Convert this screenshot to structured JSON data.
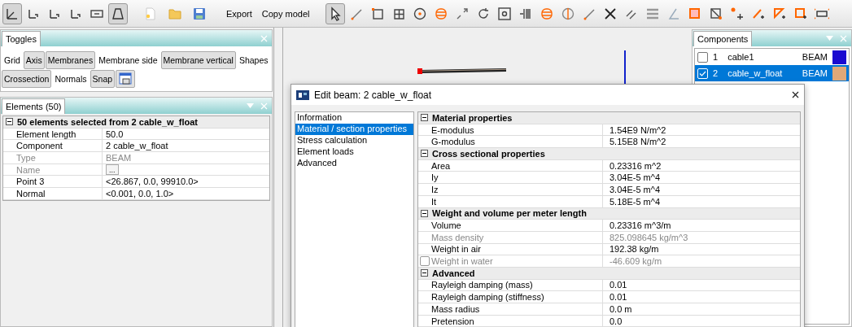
{
  "toolbar": {
    "view_tools": [
      {
        "pressed": true
      },
      {
        "pressed": false
      },
      {
        "pressed": false
      },
      {
        "pressed": false
      },
      {
        "pressed": false
      },
      {
        "pressed": true
      }
    ],
    "actions": [
      "Export",
      "Copy model"
    ],
    "draw_tools": [
      {
        "pressed": true
      },
      {
        "pressed": false
      },
      {
        "pressed": false
      },
      {
        "pressed": false
      },
      {
        "pressed": false
      },
      {
        "pressed": false
      },
      {
        "pressed": false
      },
      {
        "pressed": false
      },
      {
        "pressed": false
      },
      {
        "pressed": false
      },
      {
        "pressed": false
      },
      {
        "pressed": false
      },
      {
        "pressed": false
      },
      {
        "pressed": false
      },
      {
        "pressed": false
      },
      {
        "pressed": false
      },
      {
        "pressed": false
      },
      {
        "pressed": false
      },
      {
        "pressed": false
      },
      {
        "pressed": false
      },
      {
        "pressed": false
      },
      {
        "pressed": false
      },
      {
        "pressed": false
      },
      {
        "pressed": false
      }
    ]
  },
  "toggles": {
    "title": "Toggles",
    "items": [
      {
        "kind": "text",
        "label": "Grid",
        "on": false
      },
      {
        "kind": "text",
        "label": "Axis",
        "on": true
      },
      {
        "kind": "text",
        "label": "Membranes",
        "on": true
      },
      {
        "kind": "text",
        "label": "Membrane side",
        "on": false
      },
      {
        "kind": "text",
        "label": "Membrane vertical",
        "on": true
      },
      {
        "kind": "text",
        "label": "Shapes",
        "on": false
      },
      {
        "kind": "text",
        "label": "Crossection",
        "on": true
      },
      {
        "kind": "text",
        "label": "Normals",
        "on": false
      },
      {
        "kind": "text",
        "label": "Snap",
        "on": true
      },
      {
        "kind": "icon",
        "on": true
      }
    ]
  },
  "elements": {
    "title": "Elements (50)",
    "group": "50 elements selected from 2 cable_w_float",
    "rows": [
      {
        "name": "Element length",
        "value": "50.0",
        "disabled": false
      },
      {
        "name": "Component",
        "value": "2 cable_w_float",
        "disabled": false
      },
      {
        "name": "Type",
        "value": "BEAM",
        "disabled": true
      },
      {
        "name": "Name",
        "disabled": true,
        "button": "..."
      },
      {
        "name": "Point 3",
        "value": "<26.867, 0.0, 99910.0>",
        "disabled": false
      },
      {
        "name": "Normal",
        "value": "<0.001, 0.0, 1.0>",
        "disabled": false
      }
    ]
  },
  "components": {
    "title": "Components",
    "items": [
      {
        "number": "1",
        "name": "cable1",
        "type": "BEAM",
        "color": "#1a0ad0",
        "checked": false,
        "selected": false
      },
      {
        "number": "2",
        "name": "cable_w_float",
        "type": "BEAM",
        "color": "#e0a878",
        "checked": true,
        "selected": true
      }
    ]
  },
  "dialog": {
    "title": "Edit beam: 2 cable_w_float",
    "nav": [
      {
        "label": "Information",
        "selected": false
      },
      {
        "label": "Material / section properties",
        "selected": true
      },
      {
        "label": "Stress calculation",
        "selected": false
      },
      {
        "label": "Element loads",
        "selected": false
      },
      {
        "label": "Advanced",
        "selected": false
      }
    ],
    "groups": [
      {
        "title": "Material properties",
        "rows": [
          {
            "name": "E-modulus",
            "value": "1.54E9 N/m^2",
            "disabled": false
          },
          {
            "name": "G-modulus",
            "value": "5.15E8 N/m^2",
            "disabled": false
          }
        ]
      },
      {
        "title": "Cross sectional properties",
        "rows": [
          {
            "name": "Area",
            "value": "0.23316 m^2",
            "disabled": false
          },
          {
            "name": "Iy",
            "value": "3.04E-5 m^4",
            "disabled": false
          },
          {
            "name": "Iz",
            "value": "3.04E-5 m^4",
            "disabled": false
          },
          {
            "name": "It",
            "value": "5.18E-5 m^4",
            "disabled": false
          }
        ]
      },
      {
        "title": "Weight and volume per meter length",
        "rows": [
          {
            "name": "Volume",
            "value": "0.23316 m^3/m",
            "disabled": false
          },
          {
            "name": "Mass density",
            "value": "825.098645 kg/m^3",
            "disabled": true
          },
          {
            "name": "Weight in air",
            "value": "192.38 kg/m",
            "disabled": false
          },
          {
            "name": "Weight in water",
            "value": "-46.609 kg/m",
            "disabled": true,
            "checked": false
          }
        ]
      },
      {
        "title": "Advanced",
        "rows": [
          {
            "name": "Rayleigh damping (mass)",
            "value": "0.01",
            "disabled": false
          },
          {
            "name": "Rayleigh damping (stiffness)",
            "value": "0.01",
            "disabled": false
          },
          {
            "name": "Mass radius",
            "value": "0.0 m",
            "disabled": false
          },
          {
            "name": "Pretension",
            "value": "0.0",
            "disabled": false
          }
        ]
      }
    ]
  }
}
